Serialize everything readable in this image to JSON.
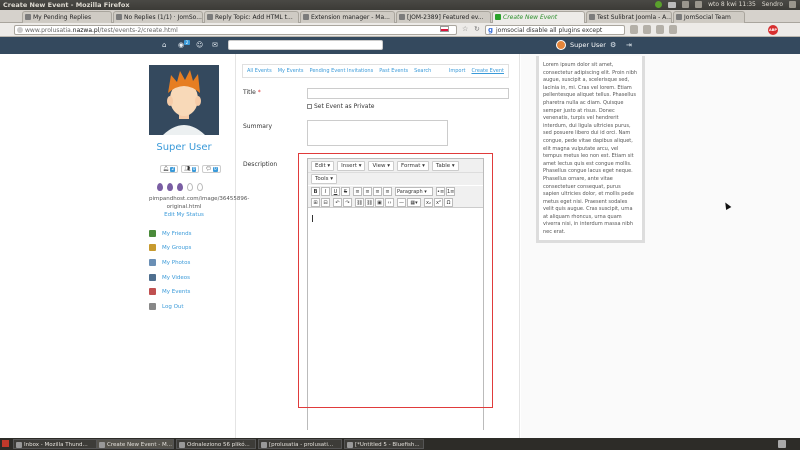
{
  "os": {
    "window_title": "Create New Event - Mozilla Firefox",
    "clock": "wto 8 kwi 11:35",
    "user": "Sendro"
  },
  "tabs": [
    {
      "label": "My Pending Replies"
    },
    {
      "label": "No Replies (1/1) · JomSo..."
    },
    {
      "label": "Reply Topic: Add HTML t..."
    },
    {
      "label": "Extension manager - Ma..."
    },
    {
      "label": "[JOM-2389] Featured ev..."
    },
    {
      "label": "Create New Event"
    },
    {
      "label": "Test Sulibrat Joomla - A..."
    },
    {
      "label": "JomSocial Team"
    }
  ],
  "browser": {
    "url_prefix": "www.prolusatia.",
    "url_host": "nazwa.pl",
    "url_path": "/test/events-2/create.html",
    "search_value": "jomsocial disable all plugins except"
  },
  "header": {
    "notif_count": "2",
    "user_label": "Super User"
  },
  "profile": {
    "name": "Super User",
    "counts": [
      {
        "n": "2"
      },
      {
        "n": "0"
      },
      {
        "n": "0"
      }
    ],
    "status": "pimpandhost.com/image/36455896-original.html",
    "edit_status": "Edit My Status",
    "menu": [
      {
        "label": "My Friends",
        "color": "#4a8a3a"
      },
      {
        "label": "My Groups",
        "color": "#c79a2e"
      },
      {
        "label": "My Photos",
        "color": "#6a8fb5"
      },
      {
        "label": "My Videos",
        "color": "#4f6f8f"
      },
      {
        "label": "My Events",
        "color": "#c05050"
      },
      {
        "label": "Log Out",
        "color": "#888888"
      }
    ]
  },
  "subnav": {
    "items": [
      "All Events",
      "My Events",
      "Pending Event Invitations",
      "Past Events",
      "Search"
    ],
    "right": [
      "Import",
      "Create Event"
    ]
  },
  "form": {
    "title_label": "Title",
    "required_mark": "*",
    "private_label": "Set Event as Private",
    "summary_label": "Summary",
    "description_label": "Description"
  },
  "editor": {
    "menus": [
      "Edit ▾",
      "Insert ▾",
      "View ▾",
      "Format ▾",
      "Table ▾"
    ],
    "tools_menu": "Tools ▾",
    "toolbar1": [
      "B",
      "I",
      "U",
      "S",
      "≡",
      "≡",
      "≡",
      "≡",
      "Paragraph ▾",
      "•≡",
      "1≡"
    ],
    "toolbar2": [
      "⊞",
      "⊟",
      "↶",
      "↷",
      "⛓",
      "⛓",
      "▣",
      "‹›",
      "—",
      "▦▾",
      "x₂",
      "x²",
      "Ω"
    ]
  },
  "sidebar": {
    "lorem": "Lorem ipsum dolor sit amet, consectetur adipiscing elit. Proin nibh augue, suscipit a, scelerisque sed, lacinia in, mi. Cras vel lorem. Etiam pellentesque aliquet tellus. Phasellus pharetra nulla ac diam. Quisque semper justo at risus. Donec venenatis, turpis vel hendrerit interdum, dui ligula ultricies purus, sed posuere libero dui id orci. Nam congue, pede vitae dapibus aliquet, elit magna vulputate arcu, vel tempus metus leo non est. Etiam sit amet lectus quis est congue mollis. Phasellus congue lacus eget neque. Phasellus ornare, ante vitae consectetuer consequat, purus sapien ultricies dolor, et mollis pede metus eget nisi. Praesent sodales velit quis augue. Cras suscipit, urna at aliquam rhoncus, urna quam viverra nisi, in interdum massa nibh nec erat."
  },
  "taskbar": [
    {
      "label": "Inbox - Mozilla Thund..."
    },
    {
      "label": "Create New Event - M..."
    },
    {
      "label": "Odnaleziono 56 plikó..."
    },
    {
      "label": "[prolusatia - prolusati..."
    },
    {
      "label": "[*Untitled 5 - Bluefish..."
    }
  ]
}
